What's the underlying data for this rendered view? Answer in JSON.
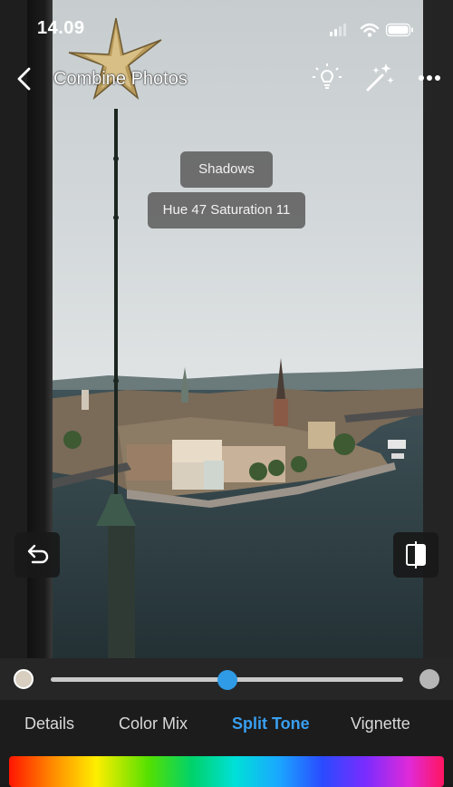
{
  "status_bar": {
    "time": "14.09"
  },
  "header": {
    "title": "Combine Photos",
    "back_icon": "chevron-left-icon",
    "icons": [
      "lightbulb-icon",
      "magic-wand-icon",
      "more-icon"
    ]
  },
  "tooltips": {
    "region": "Shadows",
    "values": "Hue 47  Saturation 11"
  },
  "buttons": {
    "undo_icon": "undo-icon",
    "compare_icon": "compare-icon"
  },
  "slider": {
    "value_fraction": 0.5,
    "accent": "#2f9be6",
    "left_swatch": "#d8cfc1",
    "right_swatch": "#b6b6b6"
  },
  "tabs": [
    {
      "label": "Details",
      "active": false
    },
    {
      "label": "Color Mix",
      "active": false
    },
    {
      "label": "Split Tone",
      "active": true
    },
    {
      "label": "Vignette",
      "active": false
    }
  ],
  "colors": {
    "active_tab": "#3a9ff0",
    "background": "#1c1c1c"
  }
}
